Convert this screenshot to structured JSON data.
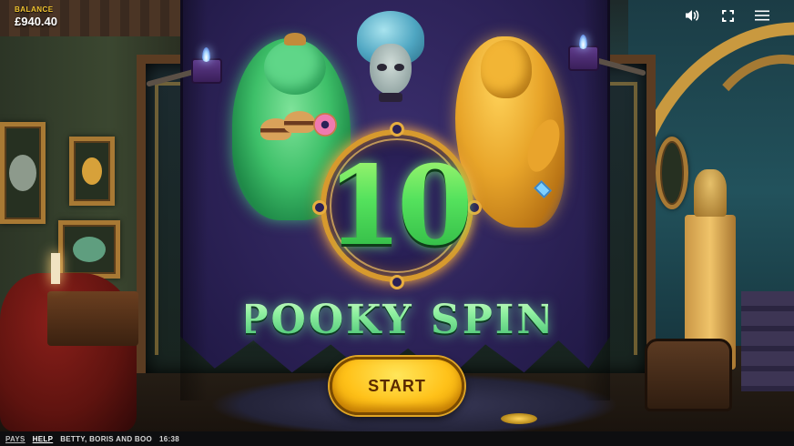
{
  "hud": {
    "balance_label": "BALANCE",
    "balance_value": "£940.40",
    "icons": [
      "sound-icon",
      "fullscreen-icon",
      "menu-icon"
    ]
  },
  "feature": {
    "spins_count": "10",
    "title": "SPOOKY SPINS",
    "start_label": "START"
  },
  "footer": {
    "pays_label": "PAYS",
    "help_label": "HELP",
    "game_name": "BETTY, BORIS AND BOO",
    "clock": "16:38"
  },
  "colors": {
    "balance_label": "#f2c530",
    "banner": "#2c2257",
    "spins_green": "#4fde58",
    "start_button": "#ffc21a",
    "ring_gold": "#d79a2e"
  }
}
